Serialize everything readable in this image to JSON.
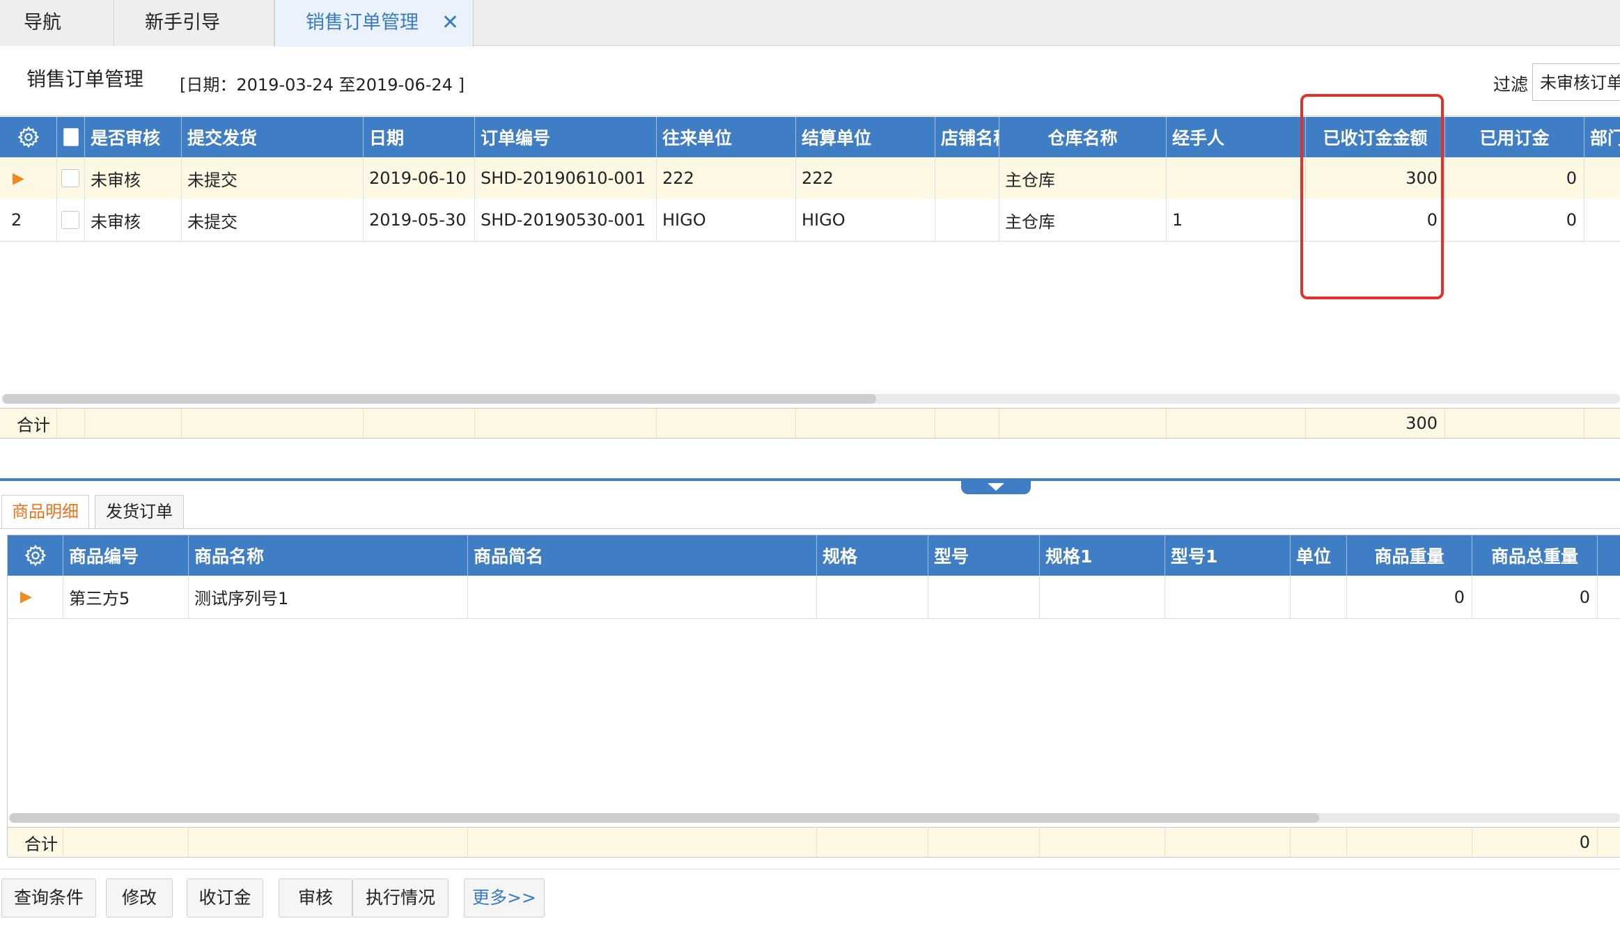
{
  "tabs": {
    "nav": "导航",
    "guide": "新手引导",
    "sales": "销售订单管理",
    "close_glyph": "✕"
  },
  "header": {
    "title": "销售订单管理",
    "date_range": "[日期：2019-03-24  至2019-06-24  ]",
    "filter_label": "过滤",
    "filter_value": "未审核订单"
  },
  "orders": {
    "columns": [
      "是否审核",
      "提交发货",
      "日期",
      "订单编号",
      "往来单位",
      "结算单位",
      "店铺名称",
      "仓库名称",
      "经手人",
      "已收订金金额",
      "已用订金",
      "部门"
    ],
    "rows": [
      {
        "no": "",
        "approved": "未审核",
        "submit": "未提交",
        "date": "2019-06-10",
        "order_no": "SHD-20190610-001",
        "partner": "222",
        "settle": "222",
        "shop": "",
        "warehouse": "主仓库",
        "handler": "",
        "received": "300",
        "used": "0",
        "dept": ""
      },
      {
        "no": "2",
        "approved": "未审核",
        "submit": "未提交",
        "date": "2019-05-30",
        "order_no": "SHD-20190530-001",
        "partner": "HIGO",
        "settle": "HIGO",
        "shop": "",
        "warehouse": "主仓库",
        "handler": "1",
        "received": "0",
        "used": "0",
        "dept": ""
      }
    ],
    "total_label": "合计",
    "total_received": "300"
  },
  "detail_tabs": {
    "goods": "商品明细",
    "shipping": "发货订单"
  },
  "goods": {
    "columns": [
      "商品编号",
      "商品名称",
      "商品简名",
      "规格",
      "型号",
      "规格1",
      "型号1",
      "单位",
      "商品重量",
      "商品总重量"
    ],
    "rows": [
      {
        "code": "第三方5",
        "name": "测试序列号1",
        "short": "",
        "spec": "",
        "model": "",
        "spec1": "",
        "model1": "",
        "unit": "",
        "weight": "0",
        "total_weight": "0"
      }
    ],
    "total_label": "合计",
    "total_weight": "0"
  },
  "buttons": {
    "query": "查询条件",
    "edit": "修改",
    "deposit": "收订金",
    "approve": "审核",
    "status": "执行情况",
    "more": "更多>>"
  },
  "icons": {
    "settings": "gear-icon",
    "row_marker": "play-arrow-icon",
    "close": "close-icon",
    "splitter": "caret-down-icon"
  },
  "colors": {
    "header_blue": "#3f7ec4",
    "accent_orange": "#e8741e",
    "highlight_red": "#e0312b",
    "selected_row": "#fdf8e4"
  }
}
